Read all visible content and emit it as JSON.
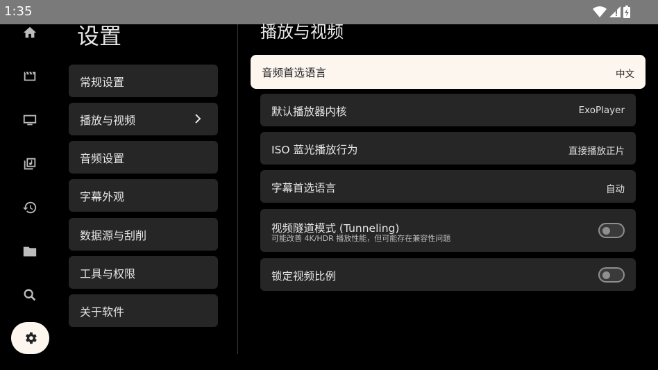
{
  "status_bar": {
    "time": "1:35"
  },
  "nav_rail": {
    "items": [
      "home-icon",
      "movie-icon",
      "tv-icon",
      "music-library-icon",
      "history-icon",
      "folder-icon",
      "search-icon",
      "settings-icon"
    ]
  },
  "page": {
    "title": "设置"
  },
  "menu": {
    "items": [
      {
        "label": "常规设置"
      },
      {
        "label": "播放与视频"
      },
      {
        "label": "音频设置"
      },
      {
        "label": "字幕外观"
      },
      {
        "label": "数据源与刮削"
      },
      {
        "label": "工具与权限"
      },
      {
        "label": "关于软件"
      }
    ]
  },
  "section": {
    "title": "播放与视频",
    "rows": [
      {
        "label": "音频首选语言",
        "value": "中文"
      },
      {
        "label": "默认播放器内核",
        "value": "ExoPlayer"
      },
      {
        "label": "ISO 蓝光播放行为",
        "value": "直接播放正片"
      },
      {
        "label": "字幕首选语言",
        "value": "自动"
      },
      {
        "label": "视频隧道模式 (Tunneling)",
        "sub": "可能改善 4K/HDR 播放性能，但可能存在兼容性问题",
        "toggle": "off"
      },
      {
        "label": "锁定视频比例",
        "toggle": "off"
      }
    ]
  },
  "colors": {
    "background": "#000000",
    "card": "#262626",
    "focused": "#fdf6ef",
    "statusbar": "#7a7a7a"
  }
}
